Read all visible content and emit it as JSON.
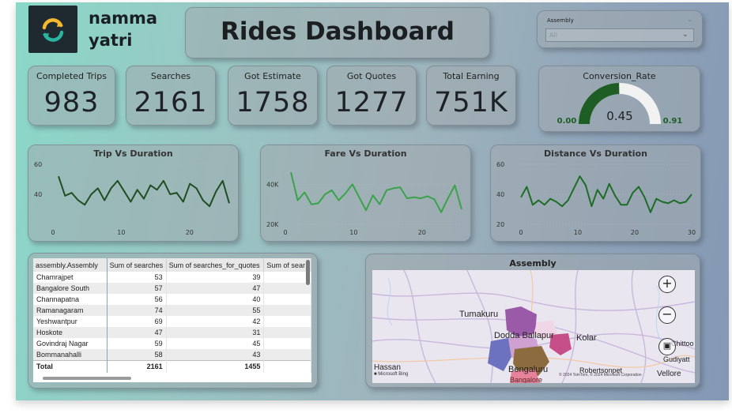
{
  "brand": {
    "line1": "namma",
    "line2": "yatri",
    "logo_icon": "refresh-arrows-icon"
  },
  "title": "Rides Dashboard",
  "slicer": {
    "label": "Assembly",
    "value": "All"
  },
  "kpis": [
    {
      "label": "Completed Trips",
      "value": "983"
    },
    {
      "label": "Searches",
      "value": "2161"
    },
    {
      "label": "Got Estimate",
      "value": "1758"
    },
    {
      "label": "Got Quotes",
      "value": "1277"
    },
    {
      "label": "Total Earning",
      "value": "751K"
    }
  ],
  "gauge": {
    "label": "Conversion_Rate",
    "value": 0.45,
    "value_text": "0.45",
    "min_text": "0.00",
    "max_text": "0.91",
    "min": 0,
    "max": 0.91,
    "fill_color": "#1e5e24",
    "track_color": "#f2f2f2"
  },
  "line_charts": [
    {
      "title": "Trip Vs Duration",
      "y_ticks": [
        "60",
        "40"
      ],
      "x_ticks": [
        "0",
        "10",
        "20"
      ],
      "color": "#1e4e22"
    },
    {
      "title": "Fare Vs Duration",
      "y_ticks": [
        "40K",
        "20K"
      ],
      "x_ticks": [
        "0",
        "10",
        "20"
      ],
      "color": "#3aa24a"
    },
    {
      "title": "Distance Vs Duration",
      "y_ticks": [
        "60",
        "40",
        "20"
      ],
      "x_ticks": [
        "0",
        "10",
        "20",
        "30"
      ],
      "color": "#1e6c28"
    }
  ],
  "chart_data": [
    {
      "type": "line",
      "title": "Trip Vs Duration",
      "x": [
        1,
        2,
        3,
        4,
        5,
        6,
        7,
        8,
        9,
        10,
        11,
        12,
        13,
        14,
        15,
        16,
        17,
        18,
        19,
        20,
        21,
        22,
        23,
        24
      ],
      "ylim": [
        20,
        60
      ],
      "series": [
        {
          "values": [
            52,
            39,
            41,
            36,
            33,
            40,
            44,
            36,
            44,
            49,
            42,
            35,
            43,
            37,
            46,
            43,
            49,
            40,
            41,
            35,
            47,
            44,
            36,
            32,
            42,
            49,
            34
          ]
        }
      ]
    },
    {
      "type": "line",
      "title": "Fare Vs Duration",
      "x": [
        1,
        2,
        3,
        4,
        5,
        6,
        7,
        8,
        9,
        10,
        11,
        12,
        13,
        14,
        15,
        16,
        17,
        18,
        19,
        20,
        21,
        22,
        23,
        24
      ],
      "ylim": [
        20000,
        50000
      ],
      "series": [
        {
          "values": [
            46000,
            32000,
            36000,
            30000,
            30500,
            35000,
            37000,
            32000,
            35500,
            40000,
            33500,
            27000,
            34500,
            30000,
            37000,
            38000,
            38500,
            33000,
            33500,
            33000,
            34000,
            32500,
            26000,
            33000,
            39500,
            27500
          ]
        }
      ]
    },
    {
      "type": "line",
      "title": "Distance Vs Duration",
      "x": [
        1,
        2,
        3,
        4,
        5,
        6,
        7,
        8,
        9,
        10,
        11,
        12,
        13,
        14,
        15,
        16,
        17,
        18,
        19,
        20,
        21,
        22,
        23,
        24,
        25,
        26,
        27,
        28,
        29
      ],
      "ylim": [
        20,
        60
      ],
      "series": [
        {
          "values": [
            38,
            45,
            33,
            36,
            33,
            37,
            35,
            32,
            36,
            44,
            52,
            46,
            32,
            43,
            37,
            47,
            39,
            33,
            33,
            41,
            45,
            38,
            28,
            37,
            35,
            34,
            36,
            34,
            35,
            40
          ]
        }
      ]
    }
  ],
  "table": {
    "columns": [
      "assembly.Assembly",
      "Sum of searches",
      "Sum of searches_for_quotes",
      "Sum of sear"
    ],
    "rows": [
      [
        "Chamrajpet",
        "53",
        "39",
        ""
      ],
      [
        "Bangalore South",
        "57",
        "47",
        ""
      ],
      [
        "Channapatna",
        "56",
        "40",
        ""
      ],
      [
        "Ramanagaram",
        "74",
        "55",
        ""
      ],
      [
        "Yeshwantpur",
        "69",
        "42",
        ""
      ],
      [
        "Hoskote",
        "47",
        "31",
        ""
      ],
      [
        "Govindraj Nagar",
        "59",
        "45",
        ""
      ],
      [
        "Bommanahalli",
        "58",
        "43",
        ""
      ]
    ],
    "total": [
      "Total",
      "2161",
      "1455",
      ""
    ]
  },
  "map": {
    "title": "Assembly",
    "places": [
      "Tumakuru",
      "Dodda Ballapur",
      "Kolar",
      "Bengaluru",
      "Bangalore",
      "Hassan",
      "Robertsonpet",
      "Gudiyatt",
      "Vellore",
      "Chittoo"
    ],
    "attribution_left": "Microsoft Bing",
    "attribution_right": "© 2024 TomTom, © 2024 Microsoft Corporation",
    "zoom_in_icon": "plus-icon",
    "zoom_out_icon": "minus-icon",
    "select_icon": "lasso-select-icon"
  }
}
